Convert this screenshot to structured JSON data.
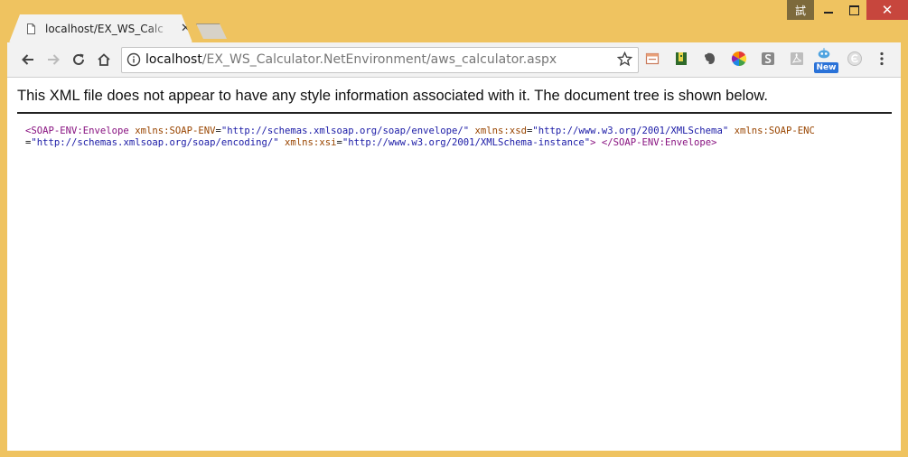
{
  "window": {
    "ime_label": "試",
    "close_label": "✕"
  },
  "tab": {
    "title": "localhost/EX_WS_Calc",
    "close_label": "✕"
  },
  "omnibox": {
    "host": "localhost",
    "path": "/EX_WS_Calculator.NetEnvironment/aws_calculator.aspx"
  },
  "extensions": {
    "new_badge": "New"
  },
  "content": {
    "notice": "This XML file does not appear to have any style information associated with it. The document tree is shown below.",
    "xml": {
      "open_tag": "<SOAP-ENV:Envelope",
      "attr1_name": "xmlns:SOAP-ENV",
      "attr1_value": "\"http://schemas.xmlsoap.org/soap/envelope/\"",
      "attr2_name": "xmlns:xsd",
      "attr2_value": "\"http://www.w3.org/2001/XMLSchema\"",
      "attr3_name": "xmlns:SOAP-ENC",
      "attr3_value": "\"http://schemas.xmlsoap.org/soap/encoding/\"",
      "attr4_name": "xmlns:xsi",
      "attr4_value": "\"http://www.w3.org/2001/XMLSchema-instance\"",
      "open_close": ">",
      "close_tag": "</SOAP-ENV:Envelope>"
    }
  },
  "colors": {
    "frame": "#efc360",
    "xml_tag": "#881280",
    "xml_attr": "#994500",
    "xml_value": "#1a1aa6"
  }
}
